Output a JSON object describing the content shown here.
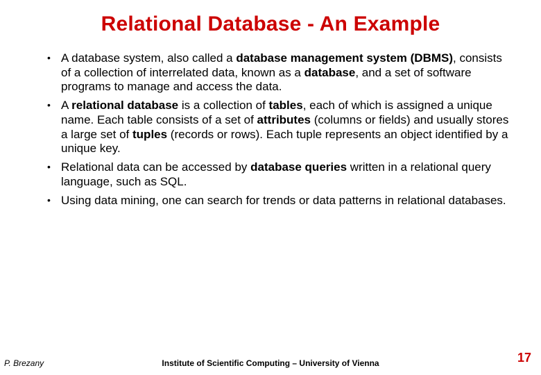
{
  "title": "Relational Database - An Example",
  "bullets": [
    {
      "segments": [
        {
          "t": "A database system, also called a "
        },
        {
          "t": "database management system (DBMS)",
          "b": true
        },
        {
          "t": ", consists of a collection of interrelated data, known as a "
        },
        {
          "t": "database",
          "b": true
        },
        {
          "t": ", and a set of software programs to manage and access the data."
        }
      ]
    },
    {
      "segments": [
        {
          "t": "A "
        },
        {
          "t": "relational database",
          "b": true
        },
        {
          "t": " is a collection of "
        },
        {
          "t": "tables",
          "b": true
        },
        {
          "t": ", each of which is assigned a unique name. Each table consists of a set of "
        },
        {
          "t": "attributes",
          "b": true
        },
        {
          "t": " (columns or fields) and usually stores a large set of "
        },
        {
          "t": "tuples",
          "b": true
        },
        {
          "t": " (records or rows). Each tuple represents an object identified by a unique key."
        }
      ]
    },
    {
      "segments": [
        {
          "t": "Relational data can be accessed by "
        },
        {
          "t": "database queries",
          "b": true
        },
        {
          "t": " written in a relational query language, such as SQL."
        }
      ]
    },
    {
      "segments": [
        {
          "t": "Using data mining, one can search for trends or data patterns in relational databases."
        }
      ]
    }
  ],
  "footer": {
    "author": "P. Brezany",
    "institute": "Institute of Scientific Computing – University of Vienna",
    "page": "17"
  }
}
